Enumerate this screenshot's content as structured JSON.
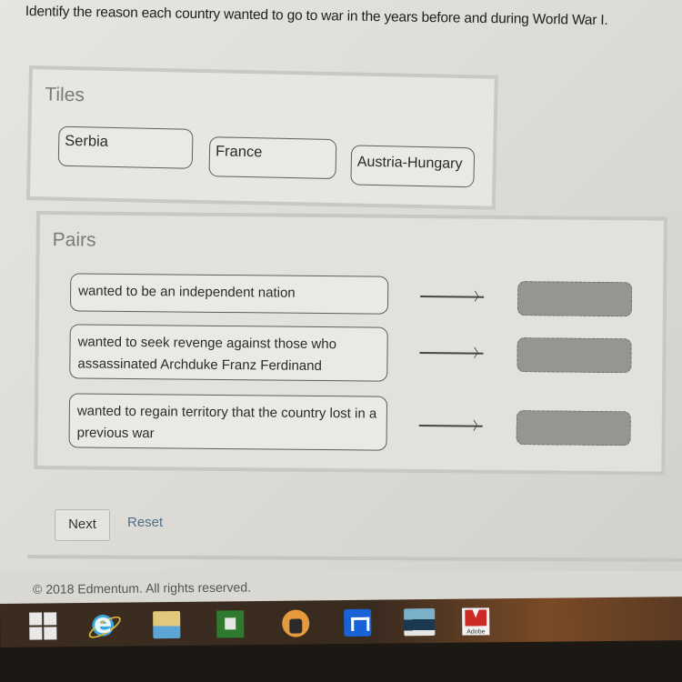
{
  "instruction": "Identify the reason each country wanted to go to war in the years before and during World War I.",
  "tiles": {
    "title": "Tiles",
    "items": [
      "Serbia",
      "France",
      "Austria-Hungary"
    ]
  },
  "pairs": {
    "title": "Pairs",
    "items": [
      {
        "description": "wanted to be an independent nation",
        "answer": ""
      },
      {
        "description": "wanted to seek revenge against those who assassinated Archduke Franz Ferdinand",
        "answer": ""
      },
      {
        "description": "wanted to regain territory that the country lost in a previous war",
        "answer": ""
      }
    ]
  },
  "buttons": {
    "next": "Next",
    "reset": "Reset"
  },
  "footer": {
    "copyright": "© 2018 Edmentum. All rights reserved."
  },
  "taskbar": {
    "icons": [
      "windows-start-icon",
      "internet-explorer-icon",
      "file-explorer-icon",
      "store-icon",
      "music-icon",
      "maxthon-icon",
      "remote-desktop-icon",
      "adobe-icon"
    ],
    "adobe_label": "Adobe"
  },
  "colors": {
    "drop_target": "#969591",
    "reset_link": "#4f6f8a"
  }
}
